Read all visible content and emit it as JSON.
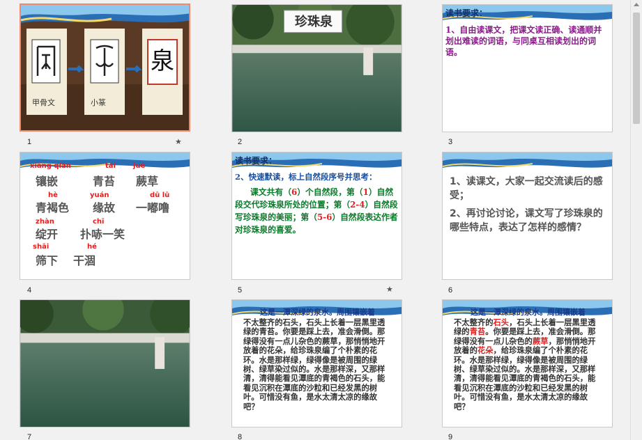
{
  "slides": [
    {
      "number": "1",
      "star": "★",
      "characters": {
        "oracle_label": "甲骨文",
        "seal_label": "小篆",
        "modern_char": "泉"
      }
    },
    {
      "number": "2",
      "title": "珍珠泉",
      "stone": "珍珠泉"
    },
    {
      "number": "3",
      "heading": "读书要求：",
      "body": "1、自由读课文，把课文读正确、读通顺并划出难读的词语，与同桌互相读划出的词语。"
    },
    {
      "number": "4",
      "vocab": [
        {
          "pinyin": "xiāng qiàn",
          "word": "镶嵌"
        },
        {
          "pinyin": "tái",
          "word": "青苔"
        },
        {
          "pinyin": "jué",
          "word": "蕨草"
        },
        {
          "pinyin": "hè",
          "word": "青褐色"
        },
        {
          "pinyin": "yuán",
          "word": "缘故"
        },
        {
          "pinyin": "dū  lū",
          "word": "一嘟噜"
        },
        {
          "pinyin": "zhàn",
          "word": "绽开"
        },
        {
          "pinyin": "chī",
          "word": "扑哧一笑"
        },
        {
          "pinyin": "shāi",
          "word": "筛下"
        },
        {
          "pinyin": "hé",
          "word": "干涸"
        }
      ]
    },
    {
      "number": "5",
      "star": "★",
      "heading": "读书要求：",
      "question": "2、快速默读，标上自然段序号并思考：",
      "answer": {
        "p1": "课文共有（",
        "n1": "6",
        "p2": "）个自然段，第（",
        "n2": "1",
        "p3": "）自然段交代珍珠泉所处的位置；第（",
        "n3": "2-4",
        "p4": "）自然段写珍珠泉的美丽；第（",
        "n4": "5-6",
        "p5": "）自然段表达作者对珍珠泉的喜爱。"
      }
    },
    {
      "number": "6",
      "q1": "1、读课文，大家一起交流读后的感受；",
      "q2": "2、再讨论讨论，课文写了珍珠泉的哪些特点，表达了怎样的感情？"
    },
    {
      "number": "7"
    },
    {
      "number": "8",
      "header": "这是一潭深绿的泉水。周围镶嵌着",
      "passage": "不太整齐的石头，石头上长着一层黑里透绿的青苔。你要是踩上去，准会滑倒。那绿得没有一点儿杂色的蕨草，那悄悄地开放着的花朵，给珍珠泉编了个朴素的花环。水是那样绿，绿得像是被周围的绿树、绿草染过似的。水是那样深，又那样清，清得能看见潭底的青褐色的石头，能看见沉积在潭底的沙粒和已经发黑的树叶。可惜没有鱼，是水太清太凉的缘故吧？"
    },
    {
      "number": "9",
      "header": "这是一潭深绿的泉水。周围镶嵌着",
      "segments": [
        "不太整齐的",
        "石头",
        "，石头上长着一层黑里透绿的",
        "青苔",
        "。你要是踩上去，准会滑倒。那绿得没有一点儿杂色的",
        "蕨草",
        "，那悄悄地开放着的",
        "花朵",
        "，给珍珠泉编了个朴素的花环。水是那样绿，绿得像是被周围的绿树、绿草染过似的。水是那样深，又那样清，清得能看见潭底的青褐色的石头，能看见沉积在潭底的沙粒和已经发黑的树叶。可惜没有鱼，是水太清太凉的缘故吧？"
      ]
    }
  ],
  "colors": {
    "selected_border": "#f08a6e",
    "purple": "#8b1a8b",
    "green": "#0a7a2a",
    "red": "#e02020",
    "navy": "#15306b"
  }
}
